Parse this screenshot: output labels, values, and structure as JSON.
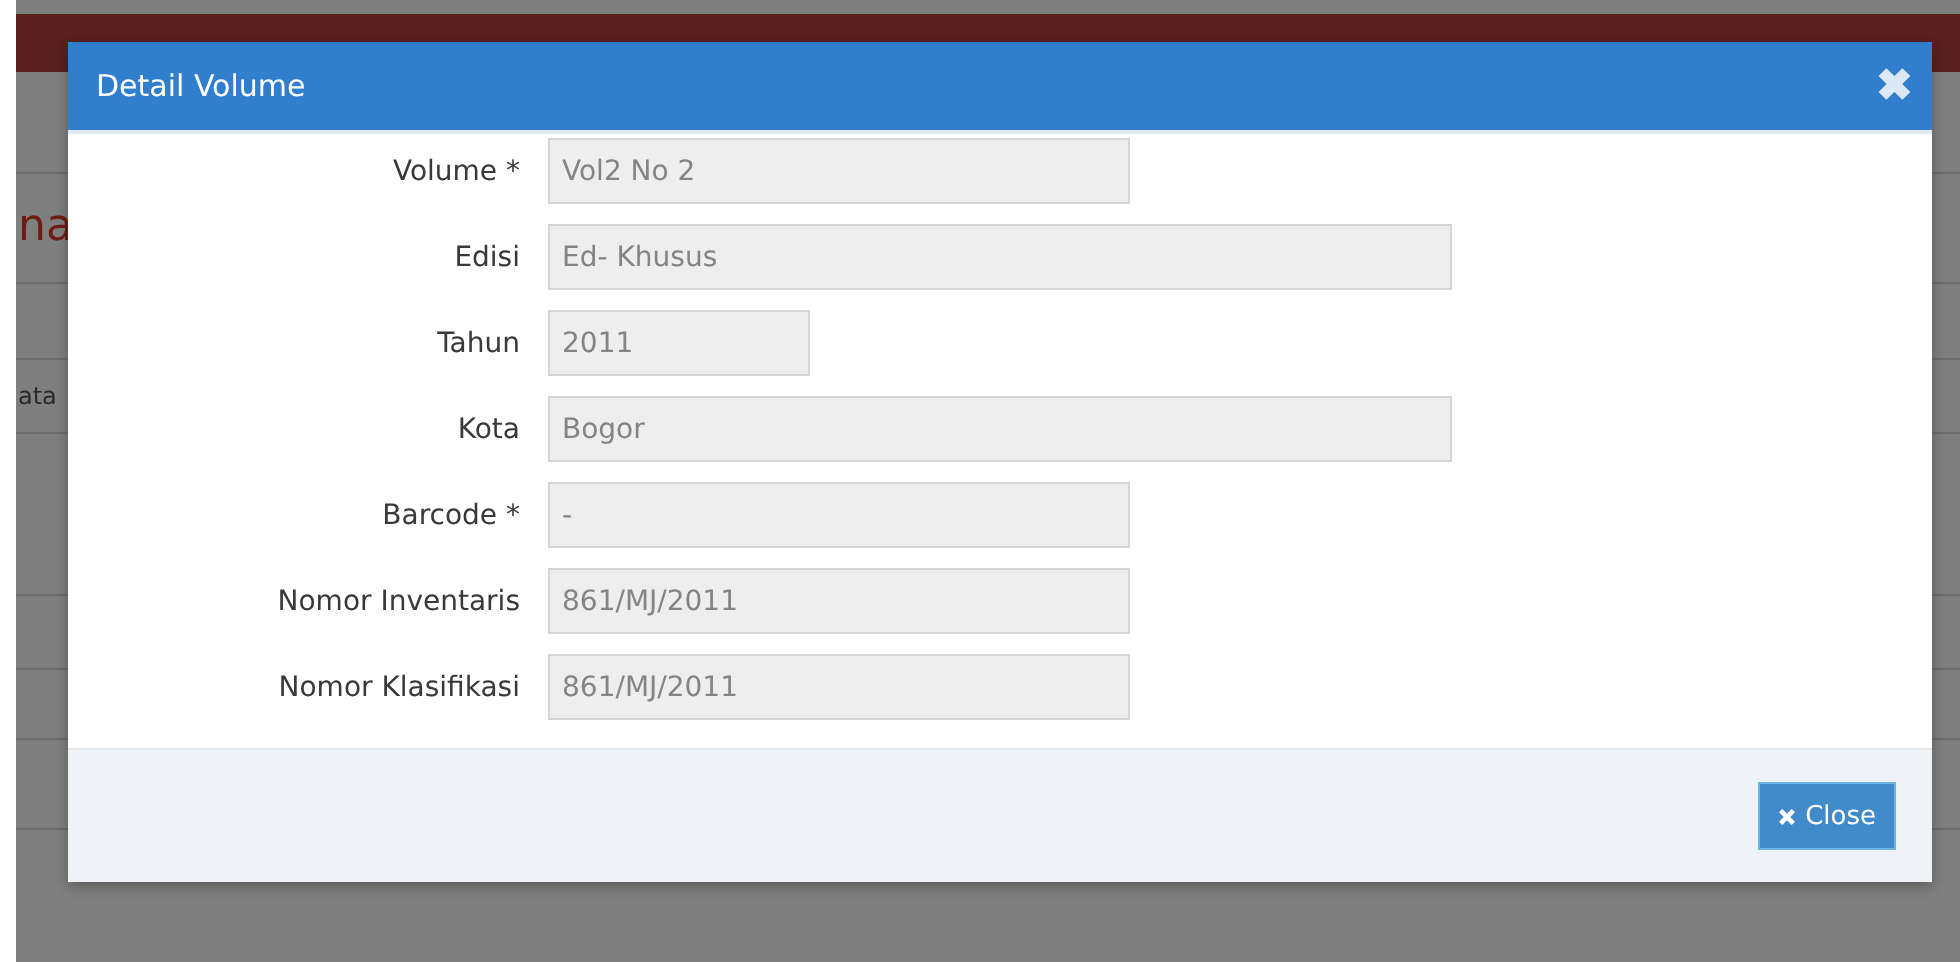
{
  "background": {
    "heading": "na",
    "table_text": "ata"
  },
  "dialog": {
    "title": "Detail Volume",
    "close_icon": "✖",
    "fields": [
      {
        "label": "Volume *",
        "value": "Vol2 No 2",
        "disabled": true
      },
      {
        "label": "Edisi",
        "value": "Ed- Khusus",
        "disabled": true
      },
      {
        "label": "Tahun",
        "value": "2011",
        "disabled": true
      },
      {
        "label": "Kota",
        "value": "Bogor",
        "disabled": true
      },
      {
        "label": "Barcode *",
        "value": "-",
        "disabled": true
      },
      {
        "label": "Nomor Inventaris",
        "value": "861/MJ/2011",
        "disabled": true
      },
      {
        "label": "Nomor Klasifikasi",
        "value": "861/MJ/2011",
        "disabled": true
      }
    ],
    "buttons": [
      {
        "label": "Close"
      }
    ]
  }
}
